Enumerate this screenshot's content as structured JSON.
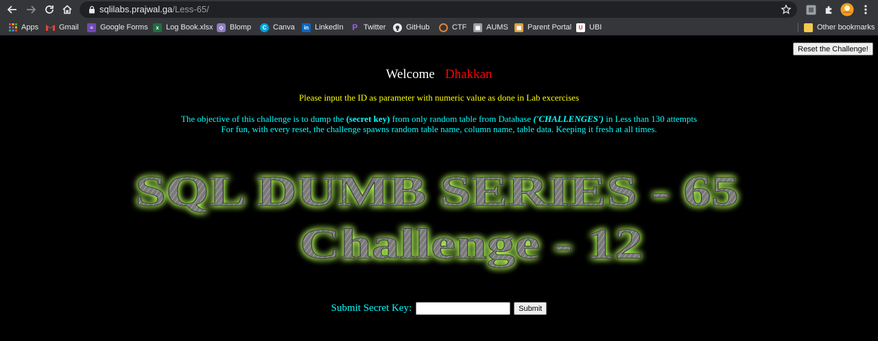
{
  "browser": {
    "url_host": "sqlilabs.prajwal.ga",
    "url_path": "/Less-65/",
    "bookmarks": [
      {
        "label": "Apps",
        "icon": "apps-grid-icon",
        "color": "#e8eaed"
      },
      {
        "label": "Gmail",
        "icon": "gmail-icon",
        "color": "#ea4335"
      },
      {
        "label": "Google Forms",
        "icon": "google-forms-icon",
        "color": "#7248b9"
      },
      {
        "label": "Log Book.xlsx",
        "icon": "excel-icon",
        "color": "#1d6f42"
      },
      {
        "label": "Blomp",
        "icon": "blomp-icon",
        "color": "#8e7cc3"
      },
      {
        "label": "Canva",
        "icon": "canva-icon",
        "color": "#00c4cc"
      },
      {
        "label": "LinkedIn",
        "icon": "linkedin-icon",
        "color": "#0a66c2"
      },
      {
        "label": "Twitter",
        "icon": "twitter-icon",
        "color": "#7b3fe4"
      },
      {
        "label": "GitHub",
        "icon": "github-icon",
        "color": "#e8eaed"
      },
      {
        "label": "CTF",
        "icon": "ctf-icon",
        "color": "#e8812f"
      },
      {
        "label": "AUMS",
        "icon": "aums-icon",
        "color": "#c0c0c0"
      },
      {
        "label": "Parent Portal",
        "icon": "parent-portal-icon",
        "color": "#d9a441"
      },
      {
        "label": "UBI",
        "icon": "ubi-icon",
        "color": "#d0312d"
      }
    ],
    "other_bookmarks": "Other bookmarks"
  },
  "page": {
    "reset_label": "Reset the Challenge!",
    "welcome_label": "Welcome",
    "welcome_name": "Dhakkan",
    "instruction": "Please input the ID as parameter with numeric value as done in Lab excercises",
    "objective": {
      "part1": "The objective of this challenge is to dump the ",
      "secret_key": "(secret key)",
      "part2": " from only random table from Database ",
      "database": "('CHALLENGES')",
      "part3": " in Less than 130 attempts"
    },
    "fun_line": "For fun, with every reset, the challenge spawns random table name, column name, table data. Keeping it fresh at all times.",
    "banner_line1": "SQL DUMB SERIES - 65",
    "banner_line2": "Challenge - 12",
    "submit_label": "Submit Secret Key:",
    "submit_input_value": "",
    "submit_button": "Submit"
  },
  "colors": {
    "chrome_bg": "#35363a",
    "omnibox_bg": "#202124",
    "page_bg": "#000000",
    "welcome_name": "#ff0000",
    "instruction": "#ffff00",
    "objective": "#00ffff",
    "banner_glow": "#b6ff5a"
  }
}
